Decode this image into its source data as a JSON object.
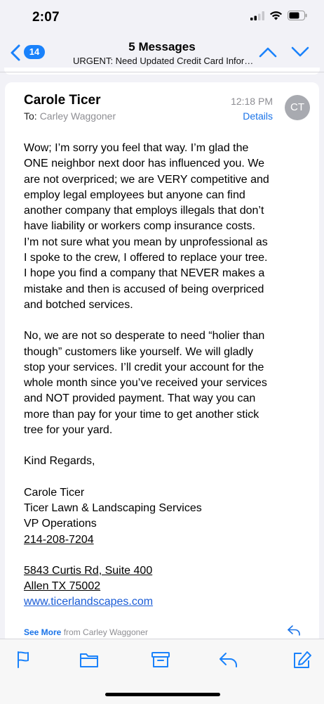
{
  "status_bar": {
    "time": "2:07"
  },
  "nav": {
    "badge_count": "14",
    "title": "5 Messages",
    "subtitle": "URGENT: Need Updated Credit Card Infor…",
    "back_icon": "chevron-left-icon",
    "up_icon": "chevron-up-icon",
    "down_icon": "chevron-down-icon"
  },
  "message": {
    "sender": "Carole Ticer",
    "to_label": "To:",
    "to_name": "Carley Waggoner",
    "time": "12:18 PM",
    "details_label": "Details",
    "avatar_initials": "CT",
    "paragraph1": [
      "Wow; I’m sorry you feel that way.  I’m glad the",
      "ONE neighbor next door has influenced you.  We",
      "are not overpriced; we are VERY competitive and",
      "employ legal employees but anyone can find",
      "another company that employs illegals that don’t",
      "have liability or workers comp insurance costs.",
      "I’m not sure what you mean by unprofessional as",
      "I spoke to the crew, I offered to replace your tree.",
      "I hope you find a company that NEVER makes a",
      "mistake and then is accused of being overpriced",
      "and botched services."
    ],
    "paragraph2": [
      "No, we are not so desperate to need “holier than",
      "though” customers like yourself.  We will gladly",
      "stop your services.  I’ll credit your account for the",
      "whole month since you’ve received your services",
      "and NOT provided payment.  That way you can",
      "more than pay for your time to get another stick",
      "tree for your yard."
    ],
    "closing": "Kind Regards,",
    "signature": {
      "name": "Carole Ticer",
      "company": "Ticer Lawn & Landscaping Services",
      "title": "VP Operations",
      "phone": "214-208-7204",
      "address1": "5843 Curtis Rd, Suite 400",
      "address2": "Allen TX 75002",
      "website": "www.ticerlandscapes.com"
    },
    "see_more_label": "See More",
    "see_more_from": "from Carley Waggoner"
  },
  "toolbar": {
    "icons": [
      "flag-icon",
      "folder-icon",
      "archive-icon",
      "reply-icon",
      "compose-icon"
    ]
  },
  "colors": {
    "accent": "#1a82fb",
    "link": "#1a5cd6",
    "background": "#f2f2f7",
    "avatar": "#a8aab0"
  }
}
